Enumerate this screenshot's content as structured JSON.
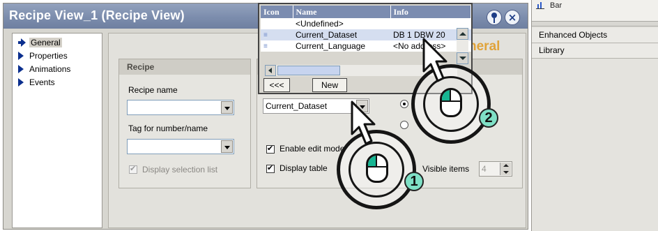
{
  "dialog": {
    "title": "Recipe View_1 (Recipe View)",
    "close_glyph": "×"
  },
  "tree": [
    {
      "label": "General",
      "selected": true
    },
    {
      "label": "Properties"
    },
    {
      "label": "Animations"
    },
    {
      "label": "Events"
    }
  ],
  "recipe_group": {
    "title": "Recipe",
    "recipe_name_label": "Recipe name",
    "recipe_name_value": "",
    "tag_label": "Tag for number/name",
    "tag_value": "",
    "display_selection_list": "Display selection list"
  },
  "middle_group": {
    "selected_tag": "Current_Dataset",
    "enable_edit_mode": "Enable edit mode",
    "display_table": "Display table"
  },
  "right_group": {
    "visible_items_label": "Visible items",
    "visible_items_value": "4",
    "ghost_title": "neral"
  },
  "right_pane": {
    "bar_label": "Bar",
    "items": [
      "Enhanced Objects",
      "Library"
    ]
  },
  "popup": {
    "columns": [
      "Icon",
      "Name",
      "Info"
    ],
    "rows": [
      {
        "icon": "",
        "name": "<Undefined>",
        "info": ""
      },
      {
        "icon": "≡",
        "name": "Current_Dataset",
        "info": "DB 1 DBW 20"
      },
      {
        "icon": "≡",
        "name": "Current_Language",
        "info": "<No address>"
      }
    ],
    "back_button": "<<<",
    "new_button": "New"
  },
  "callouts": {
    "step1": "1",
    "step2": "2"
  }
}
